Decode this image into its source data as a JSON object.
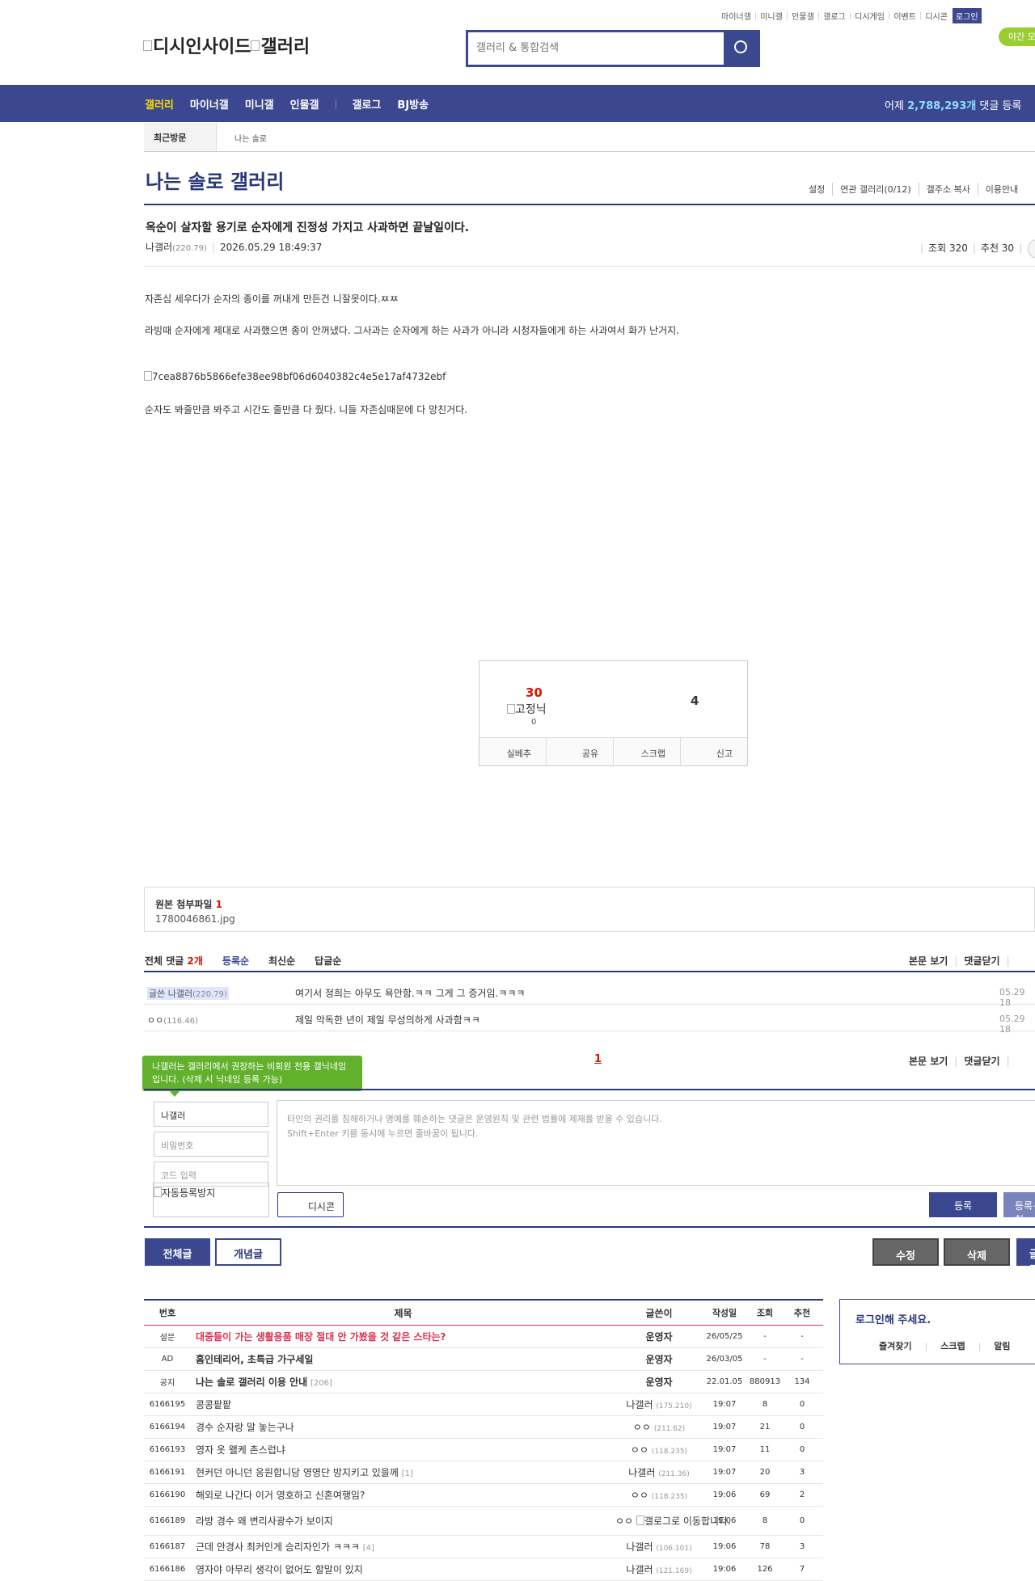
{
  "util": {
    "links": [
      "마이너갤",
      "미니갤",
      "인물갤",
      "갤로그",
      "디시게임",
      "이벤트",
      "디시콘"
    ],
    "login": "로그인",
    "night": "야간 모드"
  },
  "header": {
    "logo_alt_1": "디시인사이드",
    "logo_alt_2": "갤러리",
    "search_placeholder": "갤러리 & 통합검색"
  },
  "nav": {
    "items": [
      "갤러리",
      "마이너갤",
      "미니갤",
      "인물갤",
      "갤로그",
      "BJ방송"
    ],
    "right_prefix": "어제",
    "right_count": "2,788,293개",
    "right_suffix": "댓글 등록"
  },
  "visit": {
    "label": "최근방문",
    "item": "나는 솔로"
  },
  "gallery": {
    "title": "나는 솔로 갤러리",
    "links": [
      "설정",
      "연관 갤러리(0/12)",
      "갤주소 복사",
      "이용안내"
    ]
  },
  "post": {
    "title": "옥순이 살자할 용기로 순자에게 진정성 가지고 사과하면 끝날일이다.",
    "nick": "나갤러",
    "ip": "(220.79)",
    "date": "2026.05.29 18:49:37",
    "views": "조회 320",
    "recs": "추천 30",
    "body": [
      "자존심 세우다가 순자의 종이를 꺼내게 만든건 니잘못이다.ㅉㅉ",
      "라빙때 순자에게 제대로 사과했으면 종이 안꺼냈다. 그사과는 순자에게 하는 사과가 아니라 시청자들에게 하는 사과여서 화가 난거지.",
      "순자도 봐줄만큼 봐주고 시간도 줄만큼 다 줬다. 니들 자존심때문에 다 망친거다."
    ],
    "image_alt": "7cea8876b5866efe38ee98bf06d6040382c4e5e17af4732ebf"
  },
  "vote": {
    "up": "30",
    "gonick_alt": "고정닉",
    "gonick_count": "0",
    "down": "4",
    "actions": [
      "실베추",
      "공유",
      "스크랩",
      "신고"
    ]
  },
  "attach": {
    "label": "원본 첨부파일",
    "count": "1",
    "file": "1780046861.jpg"
  },
  "comments": {
    "total_label": "전체 댓글",
    "total_count": "2개",
    "sorts": [
      "등록순",
      "최신순",
      "답글순"
    ],
    "tools": [
      "본문 보기",
      "댓글닫기"
    ],
    "items": [
      {
        "nick": "글쓴 나갤러",
        "ip": "(220.79)",
        "text": "여기서 정희는 아무도 욕안함.ㅋㅋ 그게 그 증거임.ㅋㅋㅋ",
        "date": "05.29 18"
      },
      {
        "nick": "ㅇㅇ",
        "ip": "(116.46)",
        "text": "제일 악독한 년이 제일 무성의하게 사과함ㅋㅋ",
        "date": "05.29 18"
      }
    ],
    "page": "1"
  },
  "write": {
    "tooltip": "나갤러는 갤러리에서 권장하는 비회원 전용 갤닉네임입니다. (삭제 시 닉네임 등록 가능)",
    "nick_value": "나갤러",
    "password_placeholder": "비밀번호",
    "code_placeholder": "코드 입력",
    "captcha_alt": "자동등록방지",
    "textarea_line1": "타인의 권리를 침해하거나 명예를 훼손하는 댓글은 운영원칙 및 관련 법률에 제재를 받을 수 있습니다.",
    "textarea_line2": "Shift+Enter 키를 동시에 누르면 줄바꿈이 됩니다.",
    "dccon": "디시콘",
    "submit": "등록",
    "submit2": "등록+추천"
  },
  "buttons": {
    "all": "전체글",
    "concept": "개념글",
    "edit": "수정",
    "delete": "삭제",
    "write": "글쓰기"
  },
  "list": {
    "headers": [
      "번호",
      "제목",
      "글쓴이",
      "작성일",
      "조회",
      "추천"
    ],
    "rows": [
      {
        "no": "설문",
        "subject": "대중들이 가는 생활용품 매장 절대 안 가봤을 것 같은 스타는?",
        "cnt": "",
        "writer": "운영자",
        "ip": "",
        "date": "26/05/25",
        "views": "-",
        "rec": "-",
        "style": "red"
      },
      {
        "no": "AD",
        "subject": "홈인테리어, 초특급 가구세일",
        "cnt": "",
        "writer": "운영자",
        "ip": "",
        "date": "26/03/05",
        "views": "-",
        "rec": "-",
        "style": "bold"
      },
      {
        "no": "공지",
        "subject": "나는 솔로 갤러리 이용 안내",
        "cnt": "[206]",
        "writer": "운영자",
        "ip": "",
        "date": "22.01.05",
        "views": "880913",
        "rec": "134",
        "style": "bold"
      },
      {
        "no": "6166195",
        "subject": "콩콩팥팥",
        "cnt": "",
        "writer": "나갤러",
        "ip": "(175.210)",
        "date": "19:07",
        "views": "8",
        "rec": "0",
        "style": ""
      },
      {
        "no": "6166194",
        "subject": "경수 순자랑 말 놓는구나",
        "cnt": "",
        "writer": "ㅇㅇ",
        "ip": "(211.62)",
        "date": "19:07",
        "views": "21",
        "rec": "0",
        "style": ""
      },
      {
        "no": "6166193",
        "subject": "영자 옷 왤케 촌스럽냐",
        "cnt": "",
        "writer": "ㅇㅇ",
        "ip": "(118.235)",
        "date": "19:07",
        "views": "11",
        "rec": "0",
        "style": ""
      },
      {
        "no": "6166191",
        "subject": "현커던 아니던 응원합니당 영영단 방지키고 있을께",
        "cnt": "[1]",
        "writer": "나갤러",
        "ip": "(211.36)",
        "date": "19:07",
        "views": "20",
        "rec": "3",
        "style": ""
      },
      {
        "no": "6166190",
        "subject": "해외로 나간다 이거 영호하고 신혼여행임?",
        "cnt": "",
        "writer": "ㅇㅇ",
        "ip": "(118.235)",
        "date": "19:06",
        "views": "69",
        "rec": "2",
        "style": ""
      },
      {
        "no": "6166189",
        "subject": "라방 경수 왜 변리사광수가 보이지",
        "cnt": "",
        "writer": "ㅇㅇ",
        "ip": "",
        "writer_img_alt": "갤로그로 이동합니다.",
        "date": "19:06",
        "views": "8",
        "rec": "0",
        "style": "tall"
      },
      {
        "no": "6166187",
        "subject": "근데 안경사 최커인게 승리자인가 ㅋㅋㅋ",
        "cnt": "[4]",
        "writer": "나갤러",
        "ip": "(106.101)",
        "date": "19:06",
        "views": "78",
        "rec": "3",
        "style": ""
      },
      {
        "no": "6166186",
        "subject": "영자야 아무리 생각이 없어도 할말이 있지",
        "cnt": "",
        "writer": "나갤러",
        "ip": "(121.169)",
        "date": "19:06",
        "views": "126",
        "rec": "7",
        "style": ""
      }
    ]
  },
  "loginbox": {
    "title": "로그인해 주세요.",
    "links": [
      "즐겨찾기",
      "스크랩",
      "알림"
    ]
  },
  "colors": {
    "primary": "#3b4890",
    "dark": "#29367c",
    "red": "#d31900",
    "pink": "#d9314f",
    "green": "#62b12d"
  }
}
